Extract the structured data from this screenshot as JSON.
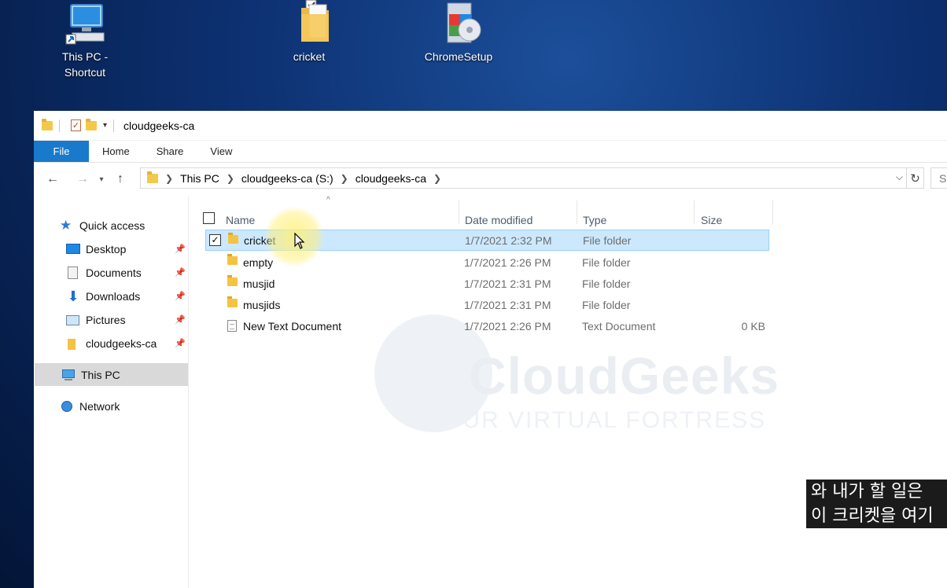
{
  "desktop": {
    "icons": [
      {
        "label_line1": "This PC -",
        "label_line2": "Shortcut",
        "icon": "computer-shortcut-icon"
      },
      {
        "label_line1": "cricket",
        "icon": "folder-icon"
      },
      {
        "label_line1": "ChromeSetup",
        "icon": "installer-icon"
      }
    ]
  },
  "window": {
    "title": "cloudgeeks-ca",
    "ribbon_tabs": [
      "File",
      "Home",
      "Share",
      "View"
    ],
    "address": {
      "crumbs": [
        "This PC",
        "cloudgeeks-ca (S:)",
        "cloudgeeks-ca"
      ]
    },
    "search_placeholder": "S"
  },
  "sidebar": {
    "quick_access": "Quick access",
    "items": [
      {
        "label": "Desktop",
        "pinned": true,
        "icon": "desktop-icon"
      },
      {
        "label": "Documents",
        "pinned": true,
        "icon": "documents-icon"
      },
      {
        "label": "Downloads",
        "pinned": true,
        "icon": "download-icon"
      },
      {
        "label": "Pictures",
        "pinned": true,
        "icon": "pictures-icon"
      },
      {
        "label": "cloudgeeks-ca",
        "pinned": true,
        "icon": "folder-icon"
      }
    ],
    "this_pc": "This PC",
    "network": "Network"
  },
  "filelist": {
    "columns": [
      "Name",
      "Date modified",
      "Type",
      "Size"
    ],
    "rows": [
      {
        "name": "cricket",
        "date": "1/7/2021 2:32 PM",
        "type": "File folder",
        "size": "",
        "selected": true,
        "icon": "folder-icon"
      },
      {
        "name": "empty",
        "date": "1/7/2021 2:26 PM",
        "type": "File folder",
        "size": "",
        "selected": false,
        "icon": "folder-icon"
      },
      {
        "name": "musjid",
        "date": "1/7/2021 2:31 PM",
        "type": "File folder",
        "size": "",
        "selected": false,
        "icon": "folder-icon"
      },
      {
        "name": "musjids",
        "date": "1/7/2021 2:31 PM",
        "type": "File folder",
        "size": "",
        "selected": false,
        "icon": "folder-icon"
      },
      {
        "name": "New Text Document",
        "date": "1/7/2021 2:26 PM",
        "type": "Text Document",
        "size": "0 KB",
        "selected": false,
        "icon": "text-document-icon"
      }
    ]
  },
  "watermark": {
    "title": "CloudGeeks",
    "subtitle": "YOUR VIRTUAL FORTRESS"
  },
  "subtitles": {
    "line1": "와 내가 할 일은",
    "line2": "이 크리켓을 여기"
  },
  "colors": {
    "file_tab": "#1979ca",
    "selection_bg": "#cce8ff",
    "selection_border": "#99d1ff",
    "folder": "#f5c342"
  }
}
